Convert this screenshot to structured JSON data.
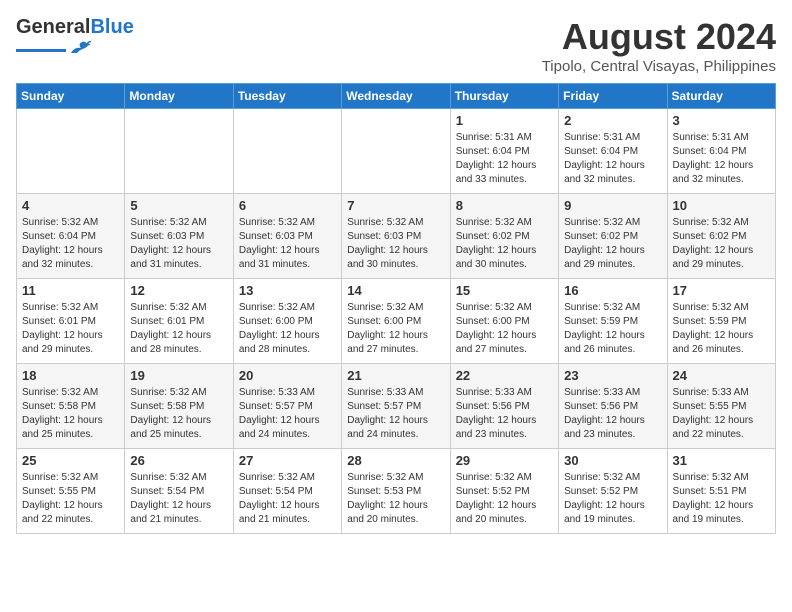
{
  "header": {
    "logo_general": "General",
    "logo_blue": "Blue",
    "month_title": "August 2024",
    "subtitle": "Tipolo, Central Visayas, Philippines"
  },
  "days_of_week": [
    "Sunday",
    "Monday",
    "Tuesday",
    "Wednesday",
    "Thursday",
    "Friday",
    "Saturday"
  ],
  "weeks": [
    [
      {
        "date": "",
        "content": ""
      },
      {
        "date": "",
        "content": ""
      },
      {
        "date": "",
        "content": ""
      },
      {
        "date": "",
        "content": ""
      },
      {
        "date": "1",
        "content": "Sunrise: 5:31 AM\nSunset: 6:04 PM\nDaylight: 12 hours\nand 33 minutes."
      },
      {
        "date": "2",
        "content": "Sunrise: 5:31 AM\nSunset: 6:04 PM\nDaylight: 12 hours\nand 32 minutes."
      },
      {
        "date": "3",
        "content": "Sunrise: 5:31 AM\nSunset: 6:04 PM\nDaylight: 12 hours\nand 32 minutes."
      }
    ],
    [
      {
        "date": "4",
        "content": "Sunrise: 5:32 AM\nSunset: 6:04 PM\nDaylight: 12 hours\nand 32 minutes."
      },
      {
        "date": "5",
        "content": "Sunrise: 5:32 AM\nSunset: 6:03 PM\nDaylight: 12 hours\nand 31 minutes."
      },
      {
        "date": "6",
        "content": "Sunrise: 5:32 AM\nSunset: 6:03 PM\nDaylight: 12 hours\nand 31 minutes."
      },
      {
        "date": "7",
        "content": "Sunrise: 5:32 AM\nSunset: 6:03 PM\nDaylight: 12 hours\nand 30 minutes."
      },
      {
        "date": "8",
        "content": "Sunrise: 5:32 AM\nSunset: 6:02 PM\nDaylight: 12 hours\nand 30 minutes."
      },
      {
        "date": "9",
        "content": "Sunrise: 5:32 AM\nSunset: 6:02 PM\nDaylight: 12 hours\nand 29 minutes."
      },
      {
        "date": "10",
        "content": "Sunrise: 5:32 AM\nSunset: 6:02 PM\nDaylight: 12 hours\nand 29 minutes."
      }
    ],
    [
      {
        "date": "11",
        "content": "Sunrise: 5:32 AM\nSunset: 6:01 PM\nDaylight: 12 hours\nand 29 minutes."
      },
      {
        "date": "12",
        "content": "Sunrise: 5:32 AM\nSunset: 6:01 PM\nDaylight: 12 hours\nand 28 minutes."
      },
      {
        "date": "13",
        "content": "Sunrise: 5:32 AM\nSunset: 6:00 PM\nDaylight: 12 hours\nand 28 minutes."
      },
      {
        "date": "14",
        "content": "Sunrise: 5:32 AM\nSunset: 6:00 PM\nDaylight: 12 hours\nand 27 minutes."
      },
      {
        "date": "15",
        "content": "Sunrise: 5:32 AM\nSunset: 6:00 PM\nDaylight: 12 hours\nand 27 minutes."
      },
      {
        "date": "16",
        "content": "Sunrise: 5:32 AM\nSunset: 5:59 PM\nDaylight: 12 hours\nand 26 minutes."
      },
      {
        "date": "17",
        "content": "Sunrise: 5:32 AM\nSunset: 5:59 PM\nDaylight: 12 hours\nand 26 minutes."
      }
    ],
    [
      {
        "date": "18",
        "content": "Sunrise: 5:32 AM\nSunset: 5:58 PM\nDaylight: 12 hours\nand 25 minutes."
      },
      {
        "date": "19",
        "content": "Sunrise: 5:32 AM\nSunset: 5:58 PM\nDaylight: 12 hours\nand 25 minutes."
      },
      {
        "date": "20",
        "content": "Sunrise: 5:33 AM\nSunset: 5:57 PM\nDaylight: 12 hours\nand 24 minutes."
      },
      {
        "date": "21",
        "content": "Sunrise: 5:33 AM\nSunset: 5:57 PM\nDaylight: 12 hours\nand 24 minutes."
      },
      {
        "date": "22",
        "content": "Sunrise: 5:33 AM\nSunset: 5:56 PM\nDaylight: 12 hours\nand 23 minutes."
      },
      {
        "date": "23",
        "content": "Sunrise: 5:33 AM\nSunset: 5:56 PM\nDaylight: 12 hours\nand 23 minutes."
      },
      {
        "date": "24",
        "content": "Sunrise: 5:33 AM\nSunset: 5:55 PM\nDaylight: 12 hours\nand 22 minutes."
      }
    ],
    [
      {
        "date": "25",
        "content": "Sunrise: 5:32 AM\nSunset: 5:55 PM\nDaylight: 12 hours\nand 22 minutes."
      },
      {
        "date": "26",
        "content": "Sunrise: 5:32 AM\nSunset: 5:54 PM\nDaylight: 12 hours\nand 21 minutes."
      },
      {
        "date": "27",
        "content": "Sunrise: 5:32 AM\nSunset: 5:54 PM\nDaylight: 12 hours\nand 21 minutes."
      },
      {
        "date": "28",
        "content": "Sunrise: 5:32 AM\nSunset: 5:53 PM\nDaylight: 12 hours\nand 20 minutes."
      },
      {
        "date": "29",
        "content": "Sunrise: 5:32 AM\nSunset: 5:52 PM\nDaylight: 12 hours\nand 20 minutes."
      },
      {
        "date": "30",
        "content": "Sunrise: 5:32 AM\nSunset: 5:52 PM\nDaylight: 12 hours\nand 19 minutes."
      },
      {
        "date": "31",
        "content": "Sunrise: 5:32 AM\nSunset: 5:51 PM\nDaylight: 12 hours\nand 19 minutes."
      }
    ]
  ]
}
